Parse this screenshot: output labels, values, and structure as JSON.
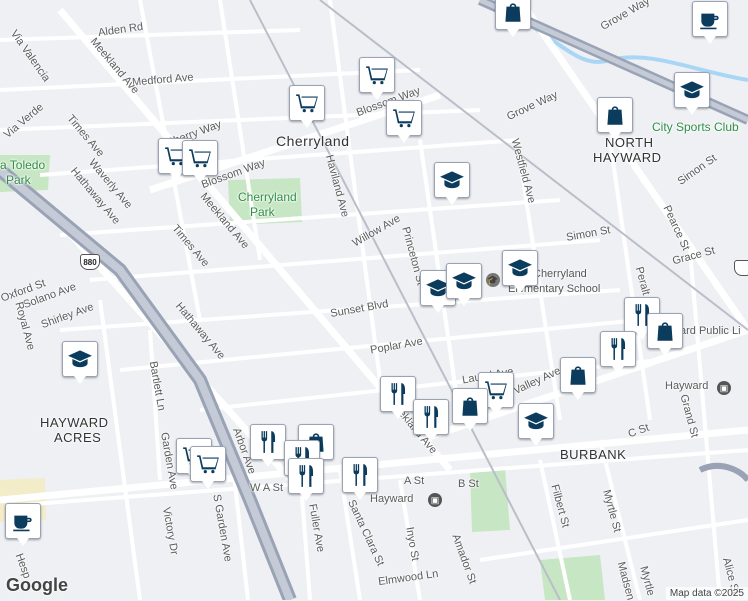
{
  "map": {
    "colors": {
      "background": "#eef0f4",
      "road": "#ffffff",
      "freeway": "#9aa3b5",
      "park": "#c7e6c4",
      "water": "#a9d6f5",
      "rail": "#b9bec8"
    }
  },
  "places": [
    {
      "name": "cherryland-place",
      "text": "Cherryland"
    },
    {
      "name": "hayward-acres-place-1",
      "text": "HAYWARD"
    },
    {
      "name": "hayward-acres-place-2",
      "text": "ACRES"
    },
    {
      "name": "north-hayward-place-1",
      "text": "NORTH"
    },
    {
      "name": "north-hayward-place-2",
      "text": "HAYWARD"
    },
    {
      "name": "burbank-place",
      "text": "BURBANK"
    }
  ],
  "parks": [
    {
      "name": "cherryland-park-label-1",
      "text": "Cherryland"
    },
    {
      "name": "cherryland-park-label-2",
      "text": "Park"
    },
    {
      "name": "toledo-park-label-1",
      "text": "a Toledo"
    },
    {
      "name": "toledo-park-label-2",
      "text": "Park"
    },
    {
      "name": "city-sports-club-label",
      "text": "City Sports Club"
    }
  ],
  "streets": [
    "Alden Rd",
    "Medford Ave",
    "Meekland Ave",
    "Via Valencia",
    "Via Verde",
    "Times Ave",
    "Waverly Ave",
    "Hathaway Ave",
    "Cherry Way",
    "Blossom Way",
    "Haviland Ave",
    "Willow Ave",
    "Princeton St",
    "Sunset Blvd",
    "Poplar Ave",
    "Laurel Ave",
    "Westfield Ave",
    "Grove Way",
    "Simon St",
    "Pearce St",
    "Grace St",
    "Oxford St",
    "Solano Ave",
    "Shirley Ave",
    "Royal Ave",
    "Bartlett Ln",
    "Garden Ave",
    "Arbor Ave",
    "W A St",
    "A St",
    "B St",
    "C St",
    "Fuller Ave",
    "Santa Clara St",
    "Victory Dr",
    "S Garden Ave",
    "Elmwood Ln",
    "Inyo St",
    "Amador St",
    "Filbert St",
    "Myrtle St",
    "Grand St",
    "Alice St",
    "Valley Ave",
    "Hesp",
    "Peralt",
    "Madsen",
    "Myrtle"
  ],
  "pois": [
    {
      "name": "cherryland-elementary-label-1",
      "text": "Cherryland"
    },
    {
      "name": "cherryland-elementary-label-2",
      "text": "Elementary School"
    },
    {
      "name": "hayward-library-label",
      "text": "ard Public Li"
    },
    {
      "name": "hayward-station-label",
      "text": "Hayward"
    },
    {
      "name": "hayward-bus-label",
      "text": "Hayward"
    }
  ],
  "highway_shields": [
    "880"
  ],
  "markers": [
    {
      "name": "shopping-bag-marker",
      "icon": "shopping-bag-icon"
    },
    {
      "name": "cafe-marker",
      "icon": "coffee-cup-icon"
    },
    {
      "name": "grocery-marker",
      "icon": "shopping-cart-icon"
    },
    {
      "name": "school-marker",
      "icon": "graduation-cap-icon"
    },
    {
      "name": "restaurant-marker",
      "icon": "fork-knife-icon"
    }
  ],
  "attribution": {
    "logo": "Google",
    "text": "Map data ©2025"
  }
}
